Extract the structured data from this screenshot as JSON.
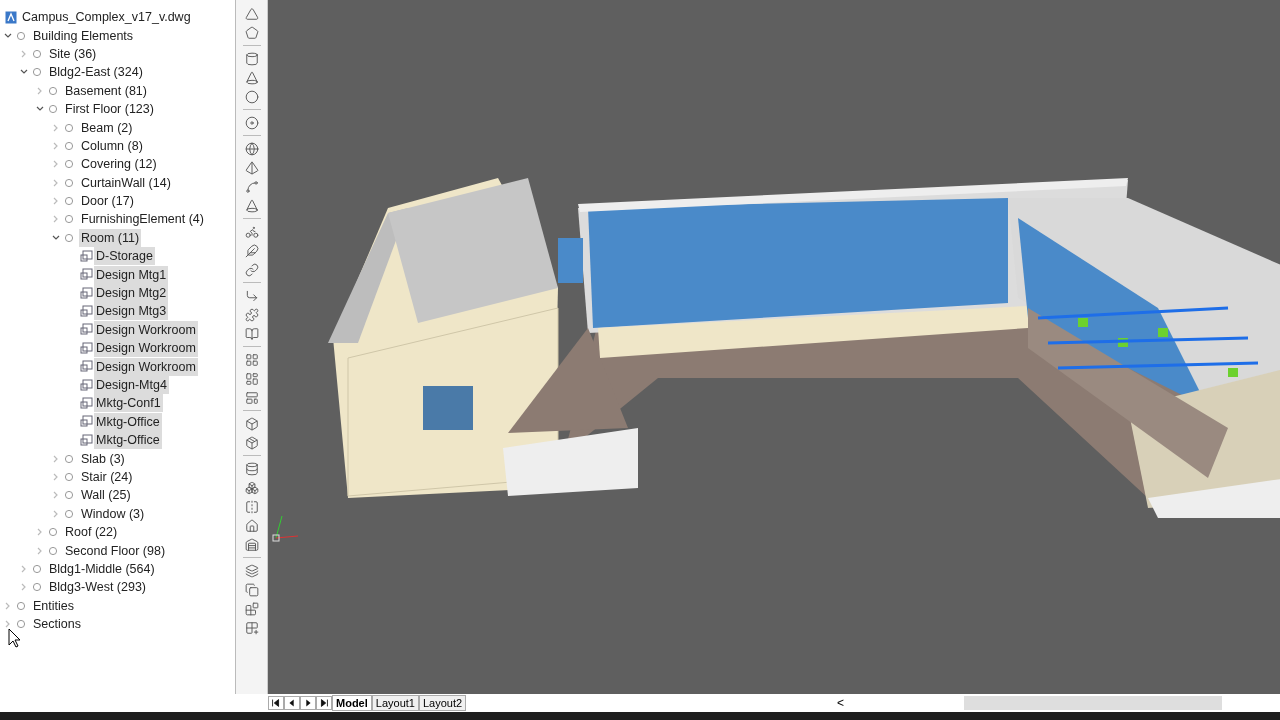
{
  "file": {
    "title": "Campus_Complex_v17_v.dwg"
  },
  "tree": [
    {
      "label": "Building Elements",
      "expanded": true,
      "selected": false,
      "kind": "group",
      "children": [
        {
          "label": "Site (36)",
          "expanded": false,
          "selected": false,
          "kind": "group"
        },
        {
          "label": "Bldg2-East (324)",
          "expanded": true,
          "selected": false,
          "kind": "group",
          "children": [
            {
              "label": "Basement (81)",
              "expanded": false,
              "selected": false,
              "kind": "group"
            },
            {
              "label": "First Floor (123)",
              "expanded": true,
              "selected": false,
              "kind": "group",
              "children": [
                {
                  "label": "Beam (2)",
                  "expanded": false,
                  "selected": false,
                  "kind": "group"
                },
                {
                  "label": "Column (8)",
                  "expanded": false,
                  "selected": false,
                  "kind": "group"
                },
                {
                  "label": "Covering (12)",
                  "expanded": false,
                  "selected": false,
                  "kind": "group"
                },
                {
                  "label": "CurtainWall (14)",
                  "expanded": false,
                  "selected": false,
                  "kind": "group"
                },
                {
                  "label": "Door (17)",
                  "expanded": false,
                  "selected": false,
                  "kind": "group"
                },
                {
                  "label": "FurnishingElement (4)",
                  "expanded": false,
                  "selected": false,
                  "kind": "group"
                },
                {
                  "label": "Room (11)",
                  "expanded": true,
                  "selected": true,
                  "kind": "group",
                  "children": [
                    {
                      "label": "D-Storage",
                      "selected": true,
                      "kind": "room"
                    },
                    {
                      "label": "Design Mtg1",
                      "selected": true,
                      "kind": "room"
                    },
                    {
                      "label": "Design Mtg2",
                      "selected": true,
                      "kind": "room"
                    },
                    {
                      "label": "Design Mtg3",
                      "selected": true,
                      "kind": "room"
                    },
                    {
                      "label": "Design Workroom",
                      "selected": true,
                      "kind": "room"
                    },
                    {
                      "label": "Design Workroom",
                      "selected": true,
                      "kind": "room"
                    },
                    {
                      "label": "Design Workroom",
                      "selected": true,
                      "kind": "room"
                    },
                    {
                      "label": "Design-Mtg4",
                      "selected": true,
                      "kind": "room"
                    },
                    {
                      "label": "Mktg-Conf1",
                      "selected": true,
                      "kind": "room"
                    },
                    {
                      "label": "Mktg-Office",
                      "selected": true,
                      "kind": "room"
                    },
                    {
                      "label": "Mktg-Office",
                      "selected": true,
                      "kind": "room"
                    }
                  ]
                },
                {
                  "label": "Slab (3)",
                  "expanded": false,
                  "selected": false,
                  "kind": "group"
                },
                {
                  "label": "Stair (24)",
                  "expanded": false,
                  "selected": false,
                  "kind": "group"
                },
                {
                  "label": "Wall (25)",
                  "expanded": false,
                  "selected": false,
                  "kind": "group"
                },
                {
                  "label": "Window (3)",
                  "expanded": false,
                  "selected": false,
                  "kind": "group"
                }
              ]
            },
            {
              "label": "Roof (22)",
              "expanded": false,
              "selected": false,
              "kind": "group"
            },
            {
              "label": "Second Floor (98)",
              "expanded": false,
              "selected": false,
              "kind": "group"
            }
          ]
        },
        {
          "label": "Bldg1-Middle (564)",
          "expanded": false,
          "selected": false,
          "kind": "group"
        },
        {
          "label": "Bldg3-West (293)",
          "expanded": false,
          "selected": false,
          "kind": "group"
        }
      ]
    },
    {
      "label": "Entities",
      "expanded": false,
      "selected": false,
      "kind": "group"
    },
    {
      "label": "Sections",
      "expanded": false,
      "selected": false,
      "kind": "group"
    }
  ],
  "layout_tabs": [
    {
      "label": "Model",
      "selected": true
    },
    {
      "label": "Layout1",
      "selected": false
    },
    {
      "label": "Layout2",
      "selected": false
    }
  ],
  "scroll_arrow": "<"
}
